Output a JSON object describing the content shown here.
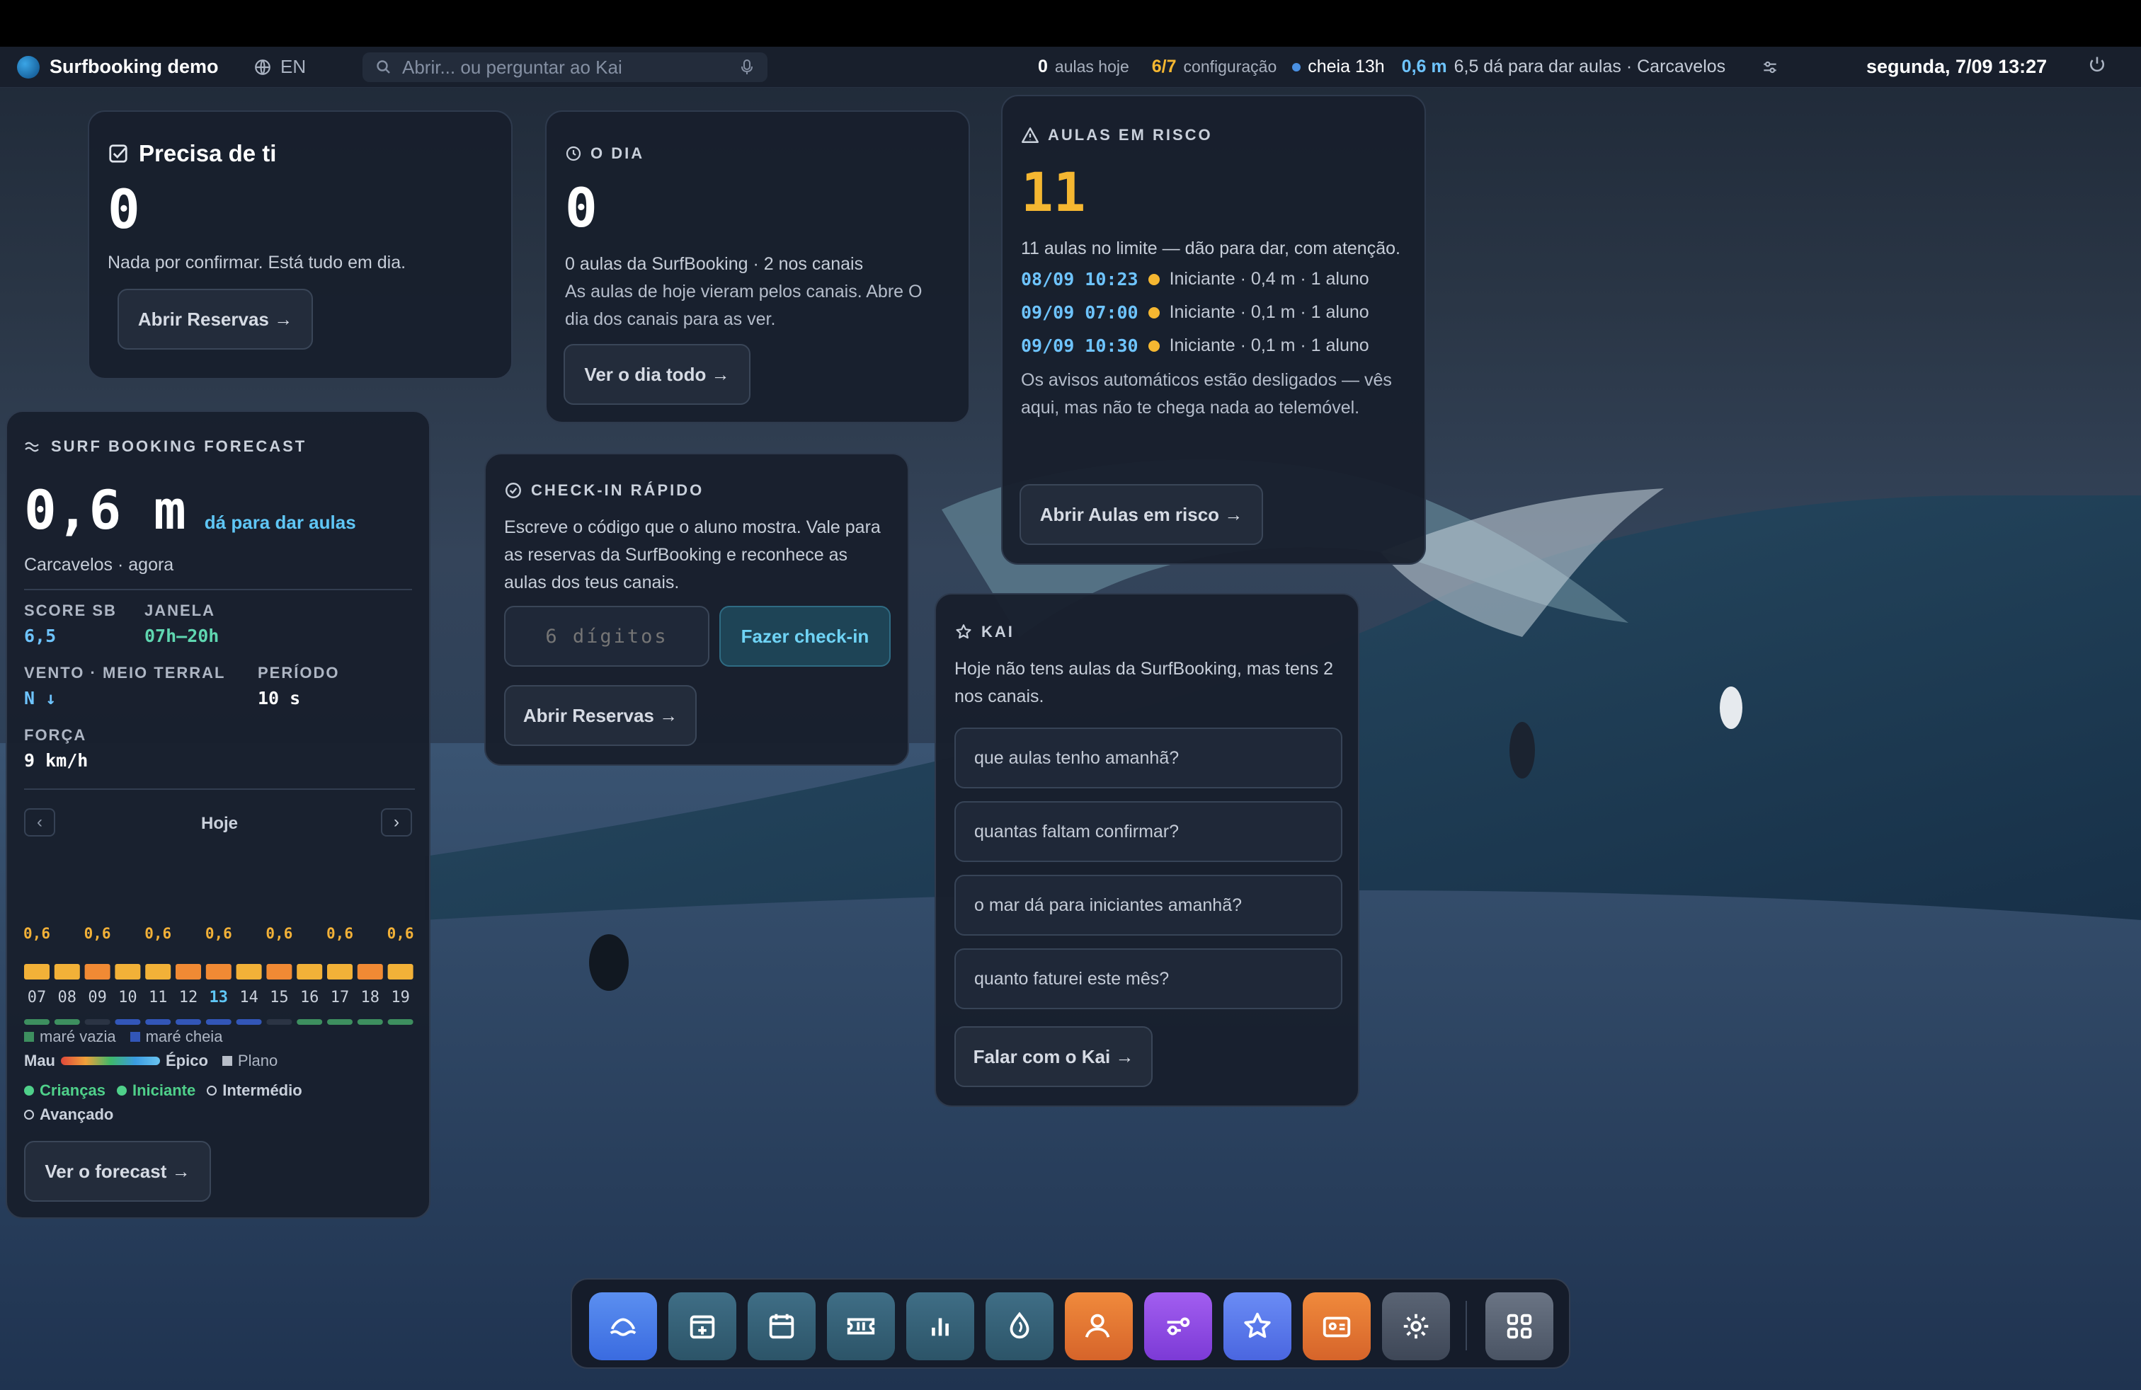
{
  "topbar": {
    "app_name": "Surfbooking demo",
    "language": "EN",
    "search_placeholder": "Abrir... ou perguntar ao Kai",
    "classes_today_value": "0",
    "classes_today_label": "aulas hoje",
    "setup_value": "6/7",
    "setup_label": "configuração",
    "tide": "cheia 13h",
    "wave_height": "0,6 m",
    "conditions": "6,5 dá para dar aulas · Carcavelos",
    "datetime": "segunda, 7/09 13:27"
  },
  "precisa": {
    "title": "Precisa de ti",
    "count": "0",
    "message": "Nada por confirmar. Está tudo em dia.",
    "button": "Abrir Reservas →"
  },
  "odia": {
    "title": "O DIA",
    "count": "0",
    "subtitle": "0 aulas da SurfBooking · 2 nos canais",
    "message": "As aulas de hoje vieram pelos canais. Abre O dia dos canais para as ver.",
    "button": "Ver o dia todo →"
  },
  "risco": {
    "title": "AULAS EM RISCO",
    "count": "11",
    "summary": "11 aulas no limite — dão para dar, com atenção.",
    "rows": [
      {
        "time": "08/09 10:23",
        "detail": "Iniciante · 0,4 m · 1 aluno"
      },
      {
        "time": "09/09 07:00",
        "detail": "Iniciante · 0,1 m · 1 aluno"
      },
      {
        "time": "09/09 10:30",
        "detail": "Iniciante · 0,1 m · 1 aluno"
      }
    ],
    "notice": "Os avisos automáticos estão desligados — vês aqui, mas não te chega nada ao telemóvel.",
    "button": "Abrir Aulas em risco →"
  },
  "forecast": {
    "title": "SURF BOOKING FORECAST",
    "height": "0,6 m",
    "verdict": "dá para dar aulas",
    "location": "Carcavelos · agora",
    "score_label": "SCORE SB",
    "score_value": "6,5",
    "window_label": "JANELA",
    "window_value": "07h–20h",
    "wind_label": "VENTO · MEIO TERRAL",
    "wind_value": "N ↓",
    "period_label": "PERÍODO",
    "period_value": "10 s",
    "force_label": "FORÇA",
    "force_value": "9 km/h",
    "day_label": "Hoje",
    "prev": "‹",
    "next": "›",
    "legend_low": "maré vazia",
    "legend_high": "maré cheia",
    "scale_bad": "Mau",
    "scale_epic": "Épico",
    "scale_flat": "Plano",
    "levels": [
      "Crianças",
      "Iniciante",
      "Intermédio",
      "Avançado"
    ],
    "button": "Ver o forecast →"
  },
  "chart_data": {
    "type": "bar",
    "categories": [
      "07",
      "08",
      "09",
      "10",
      "11",
      "12",
      "13",
      "14",
      "15",
      "16",
      "17",
      "18",
      "19"
    ],
    "values": [
      0.6,
      0.6,
      0.6,
      0.6,
      0.6,
      0.6,
      0.6,
      0.6,
      0.6,
      0.6,
      0.6,
      0.6,
      0.6
    ],
    "value_labels": [
      "0,6",
      "0,6",
      "0,6",
      "0,6",
      "0,6",
      "0,6",
      "0,6"
    ],
    "highlight": "13",
    "tide": [
      "low",
      "low",
      "none",
      "high",
      "high",
      "high",
      "high",
      "high",
      "none",
      "low",
      "low",
      "low",
      "low"
    ],
    "colors": {
      "bar_normal": "#f2b138",
      "bar_strong": "#f08a34",
      "tide_low": "#3d8f5f",
      "tide_high": "#3256b8",
      "tide_none": "#2b3444"
    }
  },
  "checkin": {
    "title": "CHECK-IN RÁPIDO",
    "message": "Escreve o código que o aluno mostra. Vale para as reservas da SurfBooking e reconhece as aulas dos teus canais.",
    "placeholder": "6 dígitos",
    "submit": "Fazer check-in",
    "button": "Abrir Reservas →"
  },
  "kai": {
    "title": "KAI",
    "message": "Hoje não tens aulas da SurfBooking, mas tens 2 nos canais.",
    "suggestions": [
      "que aulas tenho amanhã?",
      "quantas faltam confirmar?",
      "o mar dá para iniciantes amanhã?",
      "quanto faturei este mês?"
    ],
    "button": "Falar com o Kai →"
  },
  "dock": {
    "icons": [
      "surf-icon",
      "add-booking-icon",
      "calendar-icon",
      "ticket-icon",
      "chart-icon",
      "drop-icon",
      "people-icon",
      "filters-icon",
      "star-icon",
      "contact-card-icon",
      "gear-icon",
      "apps-grid-icon"
    ]
  }
}
